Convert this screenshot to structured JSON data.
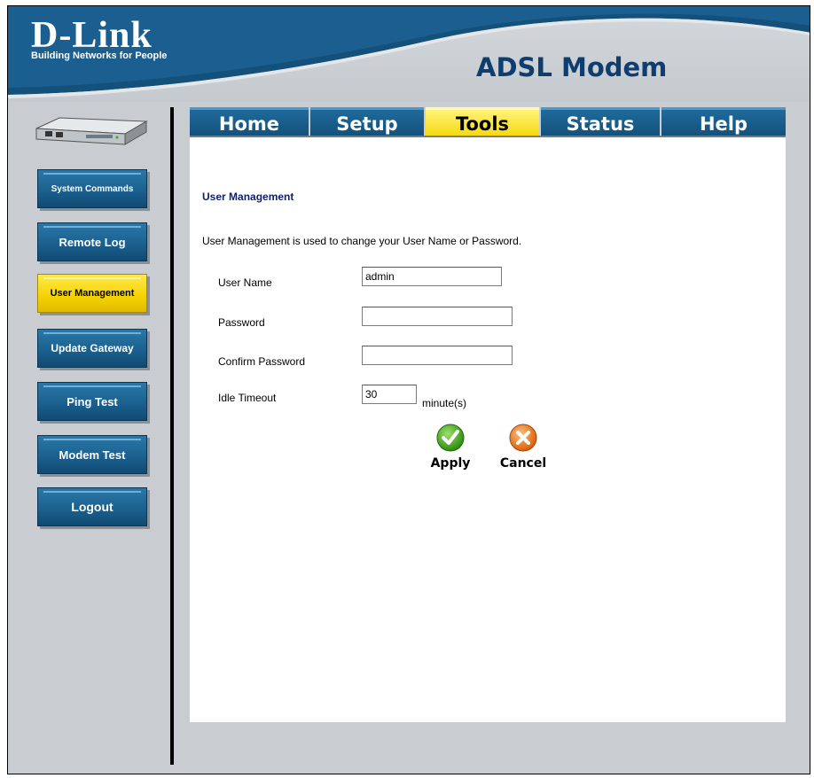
{
  "header": {
    "logo": "D-Link",
    "tagline": "Building Networks for People",
    "product": "ADSL Modem"
  },
  "tabs": [
    {
      "label": "Home",
      "active": false
    },
    {
      "label": "Setup",
      "active": false
    },
    {
      "label": "Tools",
      "active": true
    },
    {
      "label": "Status",
      "active": false
    },
    {
      "label": "Help",
      "active": false
    }
  ],
  "sidebar": {
    "items": [
      {
        "label": "System Commands",
        "active": false
      },
      {
        "label": "Remote Log",
        "active": false
      },
      {
        "label": "User Management",
        "active": true
      },
      {
        "label": "Update Gateway",
        "active": false
      },
      {
        "label": "Ping Test",
        "active": false
      },
      {
        "label": "Modem Test",
        "active": false
      },
      {
        "label": "Logout",
        "active": false
      }
    ]
  },
  "main": {
    "title": "User Management",
    "description": "User Management is used to change your User Name or Password.",
    "fields": {
      "username": {
        "label": "User Name",
        "value": "admin"
      },
      "password": {
        "label": "Password",
        "value": ""
      },
      "confirm": {
        "label": "Confirm Password",
        "value": ""
      },
      "idle": {
        "label": "Idle Timeout",
        "value": "30",
        "unit": "minute(s)"
      }
    },
    "actions": {
      "apply": "Apply",
      "cancel": "Cancel"
    }
  },
  "colors": {
    "brand_blue": "#13507a",
    "active_yellow": "#f5d90a",
    "title_navy": "#0c1f6e",
    "apply_green": "#3aa51c",
    "cancel_orange": "#e8781a"
  }
}
